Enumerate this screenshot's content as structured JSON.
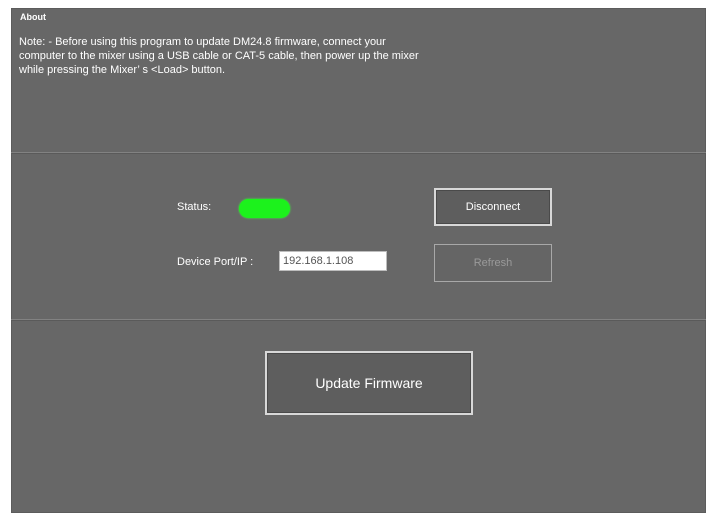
{
  "window": {
    "title": "About"
  },
  "note": {
    "lines": [
      "Note: - Before using this program to update DM24.8 firmware, connect your",
      "computer to the mixer using a USB cable or CAT-5 cable, then power up the mixer",
      "while pressing the Mixer’ s <Load> button."
    ]
  },
  "status": {
    "label": "Status:",
    "indicator_color": "#1cf21c"
  },
  "device": {
    "label": "Device Port/IP :",
    "value": "192.168.1.108"
  },
  "buttons": {
    "disconnect_label": "Disconnect",
    "refresh_label": "Refresh",
    "update_label": "Update Firmware"
  }
}
